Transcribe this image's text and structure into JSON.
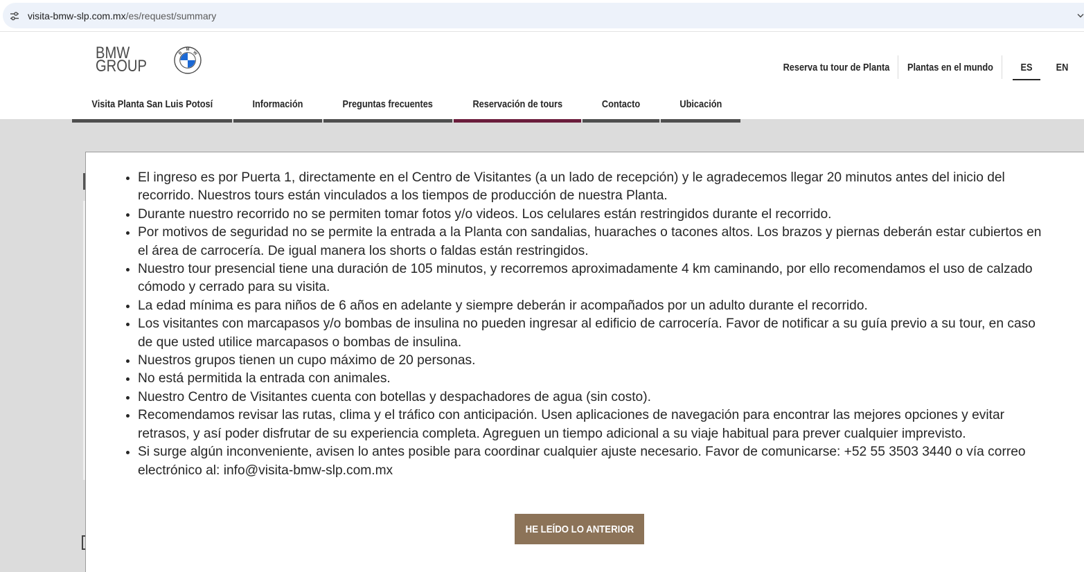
{
  "browser": {
    "url_domain": "visita-bmw-slp.com.mx",
    "url_path": "/es/request/summary",
    "icons": {
      "site_info": "tune-icon",
      "menu": "chevron-down-icon"
    }
  },
  "header": {
    "logo": {
      "line1": "BMW",
      "line2": "GROUP",
      "roundel_letters": [
        "B",
        "M",
        "W"
      ]
    },
    "utility_nav": [
      {
        "label": "Reserva tu tour de Planta"
      },
      {
        "label": "Plantas en el mundo"
      }
    ],
    "languages": [
      {
        "label": "ES",
        "active": true
      },
      {
        "label": "EN",
        "active": false
      }
    ],
    "main_nav": [
      {
        "label": "Visita Planta San Luis Potosí",
        "active": false
      },
      {
        "label": "Información",
        "active": false
      },
      {
        "label": "Preguntas frecuentes",
        "active": false
      },
      {
        "label": "Reservación de tours",
        "active": true
      },
      {
        "label": "Contacto",
        "active": false
      },
      {
        "label": "Ubicación",
        "active": false
      }
    ]
  },
  "notice": {
    "items": [
      "El ingreso es por Puerta 1, directamente en el Centro de Visitantes (a un lado de recepción) y le agradecemos llegar 20 minutos antes del inicio del recorrido. Nuestros tours están vinculados a los tiempos de producción de nuestra Planta.",
      "Durante nuestro recorrido no se permiten tomar fotos y/o videos. Los celulares están restringidos durante el recorrido.",
      "Por motivos de seguridad no se permite la entrada a la Planta con sandalias, huaraches o tacones altos. Los brazos y piernas deberán estar cubiertos en el área de carrocería. De igual manera los shorts o faldas están restringidos.",
      "Nuestro tour presencial tiene una duración de 105 minutos, y recorremos aproximadamente 4 km caminando, por ello recomendamos el uso de calzado cómodo y cerrado para su visita.",
      "La edad mínima es para niños de 6 años en adelante y siempre deberán ir acompañados por un adulto durante el recorrido.",
      "Los visitantes con marcapasos y/o bombas de insulina no pueden ingresar al edificio de carrocería. Favor de notificar a su guía previo a su tour, en caso de que usted utilice marcapasos o bombas de insulina.",
      "Nuestros grupos tienen un cupo máximo de 20 personas.",
      "No está permitida la entrada con animales.",
      "Nuestro Centro de Visitantes cuenta con botellas y despachadores de agua (sin costo).",
      "Recomendamos revisar las rutas, clima y el tráfico con anticipación. Usen aplicaciones de navegación para encontrar las mejores opciones y evitar retrasos, y así poder disfrutar de su experiencia completa. Agreguen un tiempo adicional a su viaje habitual para prever cualquier imprevisto.",
      "Si surge algún inconveniente, avisen lo antes posible para coordinar cualquier ajuste necesario. Favor de comunicarse: +52 55 3503 3440 o vía correo electrónico al: info@visita-bmw-slp.com.mx"
    ],
    "confirm_button": "HE LEÍDO LO ANTERIOR"
  },
  "colors": {
    "page_background": "#dcdcdc",
    "body_text": "#262626",
    "nav_bar": "#4f4f4f",
    "nav_bar_active": "#6b1d3c",
    "confirm_button": "#8c7358",
    "roundel_blue": "#1c69d4"
  }
}
